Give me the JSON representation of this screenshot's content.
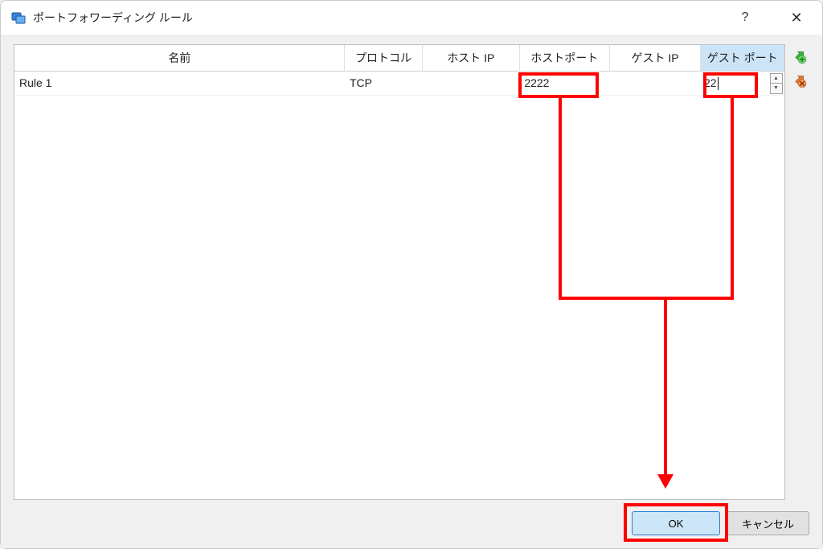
{
  "window": {
    "title": "ポートフォワーディング ルール"
  },
  "table": {
    "headers": {
      "name": "名前",
      "protocol": "プロトコル",
      "host_ip": "ホスト IP",
      "host_port": "ホストポート",
      "guest_ip": "ゲスト IP",
      "guest_port": "ゲスト ポート"
    },
    "rows": [
      {
        "name": "Rule 1",
        "protocol": "TCP",
        "host_ip": "",
        "host_port": "2222",
        "guest_ip": "",
        "guest_port": "22"
      }
    ]
  },
  "buttons": {
    "ok": "OK",
    "cancel": "キャンセル"
  },
  "icons": {
    "add": "add-rule-icon",
    "remove": "remove-rule-icon"
  }
}
